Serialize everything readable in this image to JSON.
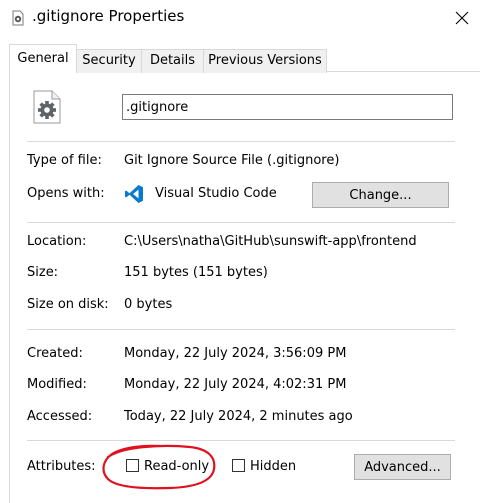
{
  "window": {
    "title": ".gitignore Properties"
  },
  "tabs": [
    {
      "label": "General"
    },
    {
      "label": "Security"
    },
    {
      "label": "Details"
    },
    {
      "label": "Previous Versions"
    }
  ],
  "general": {
    "file_name": ".gitignore",
    "type_label": "Type of file:",
    "type_value": "Git Ignore Source File (.gitignore)",
    "opens_label": "Opens with:",
    "opens_value": "Visual Studio Code",
    "change_button": "Change...",
    "location_label": "Location:",
    "location_value": "C:\\Users\\natha\\GitHub\\sunswift-app\\frontend",
    "size_label": "Size:",
    "size_value": "151 bytes (151 bytes)",
    "size_disk_label": "Size on disk:",
    "size_disk_value": "0 bytes",
    "created_label": "Created:",
    "created_value": "Monday, 22 July 2024, 3:56:09 PM",
    "modified_label": "Modified:",
    "modified_value": "Monday, 22 July 2024, 4:02:31 PM",
    "accessed_label": "Accessed:",
    "accessed_value": "Today, 22 July 2024, 2 minutes ago",
    "attributes_label": "Attributes:",
    "readonly_label": "Read-only",
    "readonly_checked": false,
    "hidden_label": "Hidden",
    "hidden_checked": false,
    "advanced_button": "Advanced..."
  },
  "icons": {
    "title": "gear-file-icon",
    "close": "close-icon",
    "file": "gear-file-icon",
    "app": "vscode-icon"
  },
  "colors": {
    "annotation": "#e0101e",
    "vscode_blue": "#0a7acc"
  }
}
